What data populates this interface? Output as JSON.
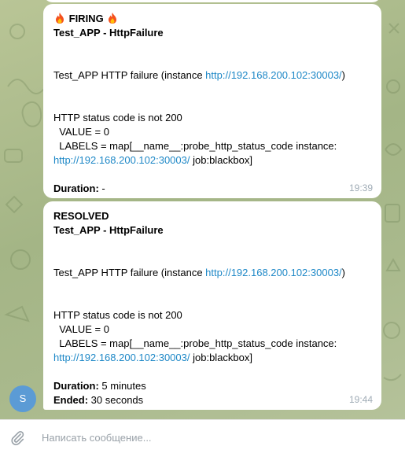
{
  "messages": [
    {
      "status_text": "FIRING",
      "status_icon": "fire-icon",
      "title": "Test_APP - HttpFailure",
      "summary_prefix": "Test_APP HTTP failure (instance ",
      "summary_link": "http://192.168.200.102:30003/",
      "summary_suffix": ")",
      "line_status_code": "HTTP status code is not 200",
      "line_value": "  VALUE = 0",
      "line_labels": "  LABELS = map[__name__:probe_http_status_code instance:",
      "labels_link": "http://192.168.200.102:30003/",
      "labels_suffix": " job:blackbox]",
      "duration_label": "Duration:",
      "duration_value": " -",
      "time": "19:39"
    },
    {
      "status_text": "RESOLVED",
      "title": "Test_APP - HttpFailure",
      "summary_prefix": "Test_APP HTTP failure (instance ",
      "summary_link": "http://192.168.200.102:30003/",
      "summary_suffix": ")",
      "line_status_code": "HTTP status code is not 200",
      "line_value": "  VALUE = 0",
      "line_labels": "  LABELS = map[__name__:probe_http_status_code instance:",
      "labels_link": "http://192.168.200.102:30003/",
      "labels_suffix": " job:blackbox]",
      "duration_label": "Duration:",
      "duration_value": " 5 minutes",
      "ended_label": "Ended:",
      "ended_value": " 30 seconds",
      "time": "19:44"
    }
  ],
  "sender_avatar": {
    "initial": "S",
    "color": "#5b9bd5"
  },
  "composer": {
    "placeholder": "Написать сообщение...",
    "attach_icon": "paperclip-icon"
  },
  "colors": {
    "link": "#1e88c7",
    "time": "#a0acb6",
    "bubble": "#ffffff"
  }
}
